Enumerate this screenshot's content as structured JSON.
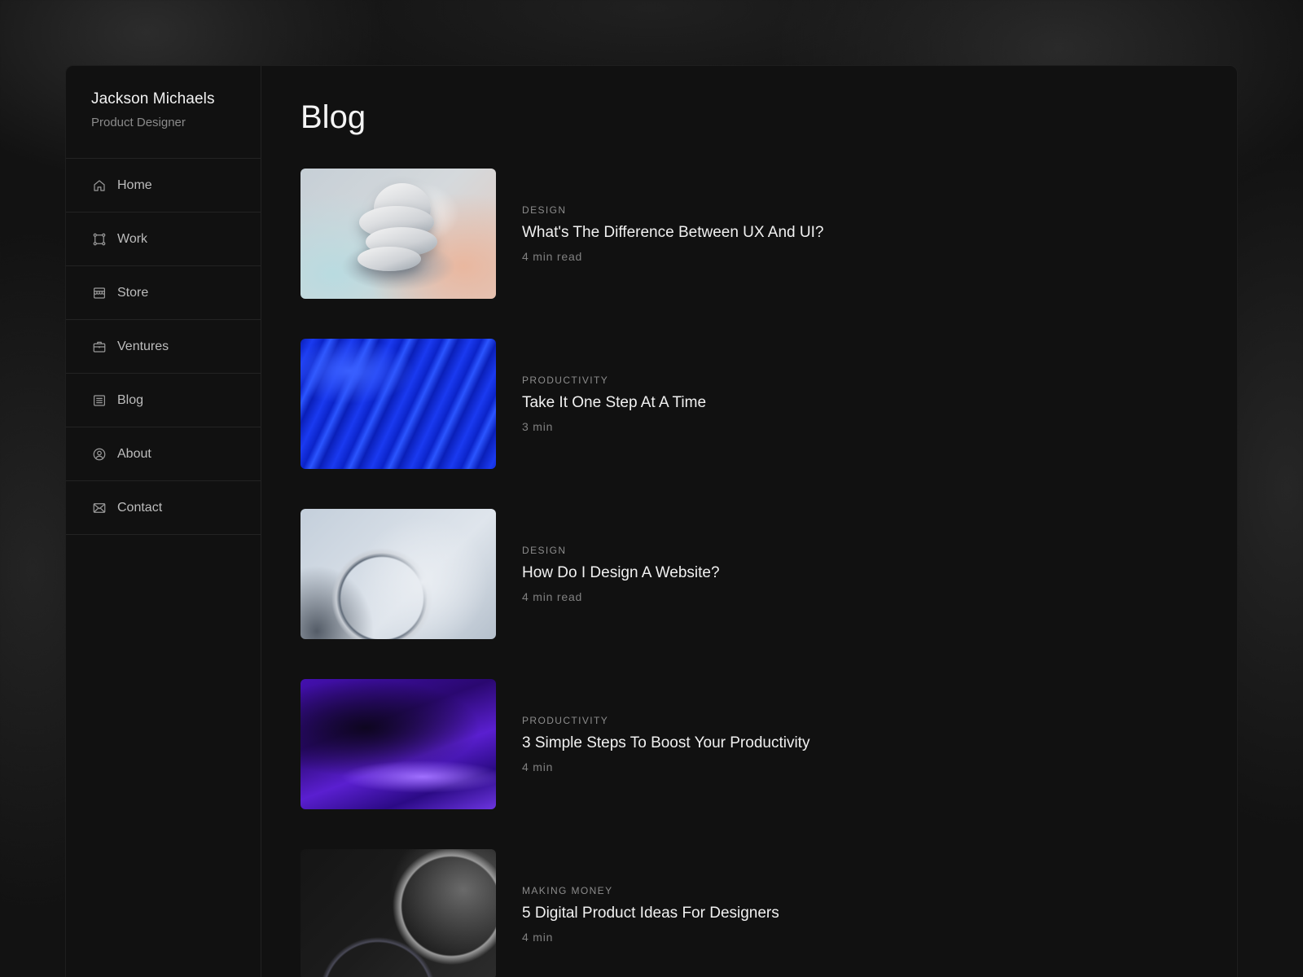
{
  "profile": {
    "name": "Jackson Michaels",
    "role": "Product Designer"
  },
  "nav": {
    "items": [
      {
        "label": "Home",
        "icon": "home-icon"
      },
      {
        "label": "Work",
        "icon": "work-icon"
      },
      {
        "label": "Store",
        "icon": "store-icon"
      },
      {
        "label": "Ventures",
        "icon": "briefcase-icon"
      },
      {
        "label": "Blog",
        "icon": "blog-icon"
      },
      {
        "label": "About",
        "icon": "user-circle-icon"
      },
      {
        "label": "Contact",
        "icon": "mail-icon"
      }
    ]
  },
  "main": {
    "title": "Blog",
    "posts": [
      {
        "category": "DESIGN",
        "title": "What's The Difference Between UX And UI?",
        "read_time": "4 min read"
      },
      {
        "category": "PRODUCTIVITY",
        "title": "Take It One Step At A Time",
        "read_time": "3 min"
      },
      {
        "category": "DESIGN",
        "title": "How Do I Design A Website?",
        "read_time": "4 min read"
      },
      {
        "category": "PRODUCTIVITY",
        "title": "3 Simple Steps To Boost Your Productivity",
        "read_time": "4 min"
      },
      {
        "category": "MAKING MONEY",
        "title": "5 Digital Product Ideas For Designers",
        "read_time": "4 min"
      }
    ]
  },
  "colors": {
    "background": "#121212",
    "panel": "#111111",
    "text_primary": "#f2f2f2",
    "text_secondary": "#8a8a8a"
  }
}
